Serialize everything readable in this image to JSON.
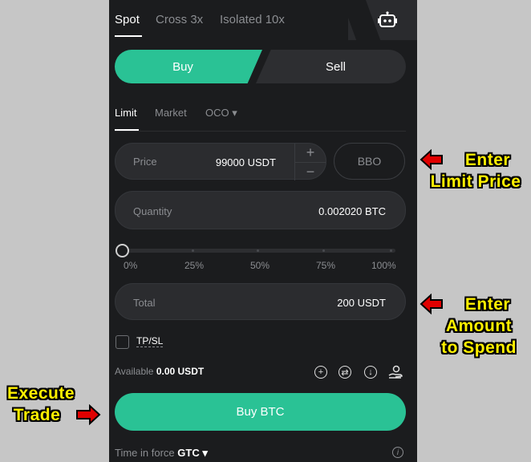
{
  "trade_modes": [
    "Spot",
    "Cross 3x",
    "Isolated 10x"
  ],
  "side": {
    "buy_label": "Buy",
    "sell_label": "Sell"
  },
  "order_types": [
    "Limit",
    "Market",
    "OCO ▾"
  ],
  "price": {
    "label": "Price",
    "value": "99000 USDT",
    "plus": "+",
    "minus": "−"
  },
  "bbo_label": "BBO",
  "quantity": {
    "label": "Quantity",
    "value": "0.002020 BTC"
  },
  "slider": {
    "labels": [
      "0%",
      "25%",
      "50%",
      "75%",
      "100%"
    ],
    "value_percent": 0
  },
  "total": {
    "label": "Total",
    "value": "200 USDT"
  },
  "tpsl_label": "TP/SL",
  "available": {
    "label": "Available",
    "value": "0.00 USDT"
  },
  "buy_button_label": "Buy BTC",
  "time_in_force": {
    "label": "Time in force",
    "value": "GTC ▾"
  },
  "annotations": {
    "limit_price": [
      "Enter",
      "Limit Price"
    ],
    "amount": [
      "Enter",
      "Amount",
      "to Spend"
    ],
    "execute": [
      "Execute",
      "Trade"
    ]
  },
  "colors": {
    "accent": "#2ac295",
    "panel": "#1b1c1e",
    "annotation": "#fff000",
    "arrow": "#e00000"
  }
}
